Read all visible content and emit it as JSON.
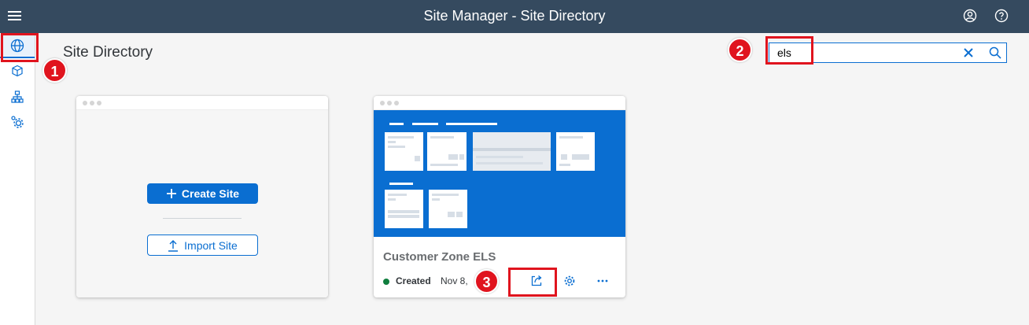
{
  "shell": {
    "title": "Site Manager - Site Directory",
    "menu_icon": "hamburger-icon",
    "user_icon": "user-avatar-icon",
    "help_icon": "help-icon"
  },
  "sidenav": {
    "items": [
      {
        "icon": "globe-icon",
        "name": "site-directory",
        "selected": true
      },
      {
        "icon": "cube-icon",
        "name": "content-manager",
        "selected": false
      },
      {
        "icon": "hierarchy-icon",
        "name": "channel-manager",
        "selected": false
      },
      {
        "icon": "settings-icon",
        "name": "settings",
        "selected": false
      }
    ]
  },
  "page": {
    "title": "Site Directory"
  },
  "search": {
    "value": "els",
    "placeholder": ""
  },
  "create_card": {
    "create_label": "Create Site",
    "import_label": "Import Site"
  },
  "site_card": {
    "name": "Customer Zone ELS",
    "status": "Created",
    "date": "Nov 8,",
    "status_color": "#107e3e",
    "preview_color": "#0a6ed1"
  },
  "annotations": {
    "marker_1": "1",
    "marker_2": "2",
    "marker_3": "3",
    "color": "#e0141e"
  }
}
